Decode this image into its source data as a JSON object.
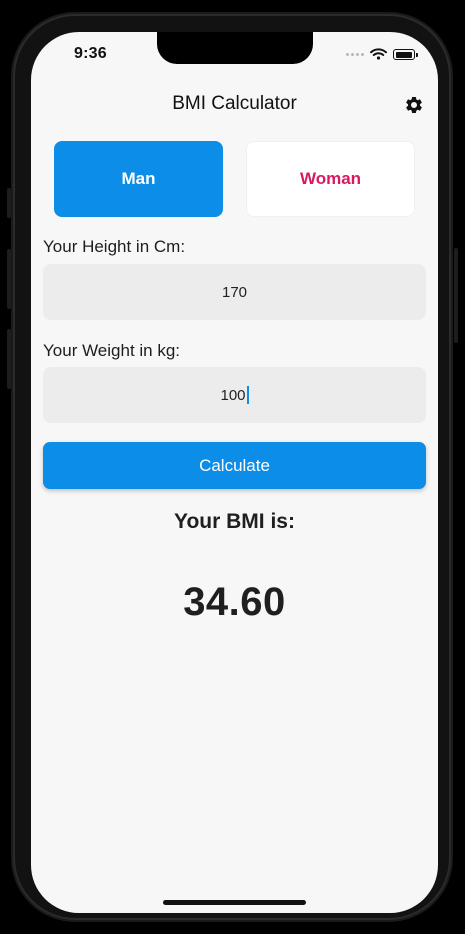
{
  "status_bar": {
    "time": "9:36"
  },
  "app_bar": {
    "title": "BMI Calculator",
    "settings_icon": "gear-icon"
  },
  "gender": {
    "man_label": "Man",
    "woman_label": "Woman",
    "selected": "Man",
    "man_color": "#0b8de8",
    "woman_color": "#d81b60"
  },
  "inputs": {
    "height_label": "Your Height in Cm:",
    "height_value": "170",
    "weight_label": "Your Weight in kg:",
    "weight_value": "100"
  },
  "actions": {
    "calculate_label": "Calculate"
  },
  "result": {
    "heading": "Your BMI is:",
    "value": "34.60"
  },
  "theme": {
    "accent": "#0b8de8",
    "background": "#f7f7f7",
    "input_background": "#ececec"
  }
}
